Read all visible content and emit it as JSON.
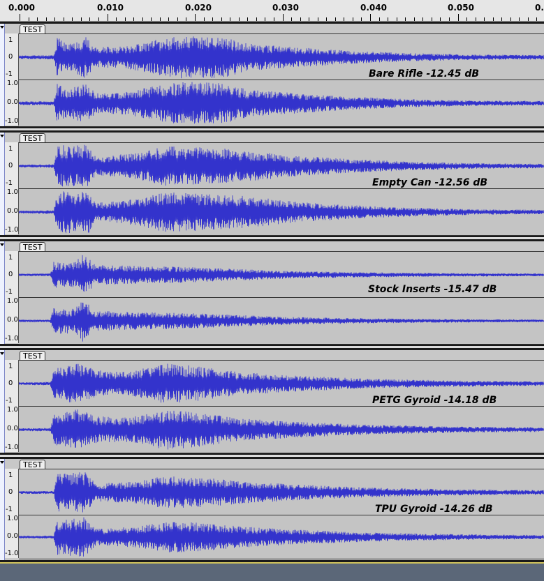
{
  "ruler": {
    "ticks": [
      "0.000",
      "0.010",
      "0.020",
      "0.030",
      "0.040",
      "0.050",
      "0.0"
    ]
  },
  "tracks": [
    {
      "title": "TEST",
      "measurement": "Bare Rifle  -12.45 dB",
      "scale": {
        "upper_top": "1",
        "upper_mid": "0",
        "upper_bottom": "-1",
        "lower_top": "1.0",
        "lower_mid": "0.0",
        "lower_bottom": "-1.0"
      }
    },
    {
      "title": "TEST",
      "measurement": "Empty Can -12.56 dB",
      "scale": {
        "upper_top": "1",
        "upper_mid": "0",
        "upper_bottom": "-1",
        "lower_top": "1.0",
        "lower_mid": "0.0",
        "lower_bottom": "-1.0"
      }
    },
    {
      "title": "TEST",
      "measurement": "Stock Inserts -15.47 dB",
      "scale": {
        "upper_top": "1",
        "upper_mid": "0",
        "upper_bottom": "-1",
        "lower_top": "1.0",
        "lower_mid": "0.0",
        "lower_bottom": "-1.0"
      }
    },
    {
      "title": "TEST",
      "measurement": "PETG Gyroid -14.18 dB",
      "scale": {
        "upper_top": "1",
        "upper_mid": "0",
        "upper_bottom": "-1",
        "lower_top": "1.0",
        "lower_mid": "0.0",
        "lower_bottom": "-1.0"
      }
    },
    {
      "title": "TEST",
      "measurement": "TPU Gyroid -14.26 dB",
      "scale": {
        "upper_top": "1",
        "upper_mid": "0",
        "upper_bottom": "-1",
        "lower_top": "1.0",
        "lower_mid": "0.0",
        "lower_bottom": "-1.0"
      }
    }
  ],
  "colors": {
    "waveform": "#3333cc",
    "background": "#c4c4c4"
  }
}
